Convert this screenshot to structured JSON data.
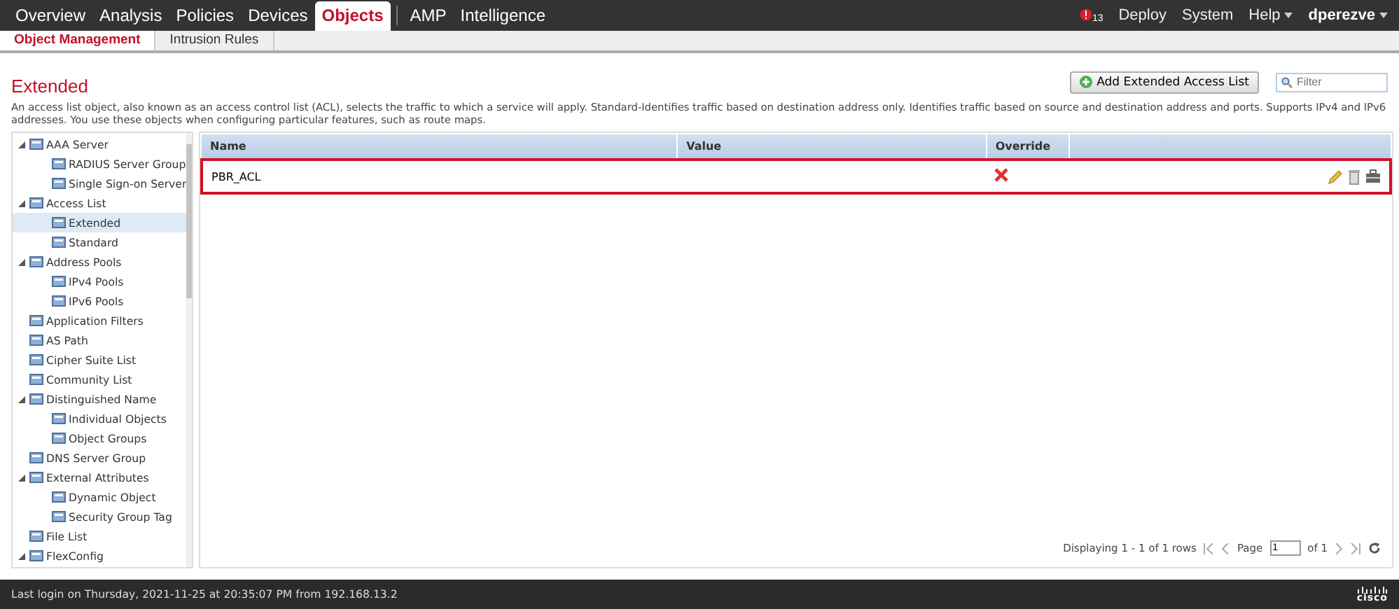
{
  "top_nav": {
    "tabs": [
      {
        "label": "Overview",
        "selected": false
      },
      {
        "label": "Analysis",
        "selected": false
      },
      {
        "label": "Policies",
        "selected": false
      },
      {
        "label": "Devices",
        "selected": false
      },
      {
        "label": "Objects",
        "selected": true
      },
      {
        "label": "AMP",
        "selected": false
      },
      {
        "label": "Intelligence",
        "selected": false
      }
    ],
    "alert_count": "13",
    "links": [
      {
        "label": "Deploy",
        "has_menu": false
      },
      {
        "label": "System",
        "has_menu": false
      },
      {
        "label": "Help",
        "has_menu": true
      }
    ],
    "user": "dperezve"
  },
  "sub_tabs": [
    {
      "label": "Object Management",
      "selected": true
    },
    {
      "label": "Intrusion Rules",
      "selected": false
    }
  ],
  "page": {
    "title": "Extended",
    "add_button": "Add Extended Access List",
    "filter_placeholder": "Filter",
    "description": "An access list object, also known as an access control list (ACL), selects the traffic to which a service will apply. Standard-Identifies traffic based on destination address only. Identifies traffic based on source and destination address and ports. Supports IPv4 and IPv6 addresses. You use these objects when configuring particular features, such as route maps."
  },
  "sidebar": {
    "items": [
      {
        "label": "AAA Server",
        "expanded": true,
        "selected": false,
        "children": [
          {
            "label": "RADIUS Server Group",
            "selected": false
          },
          {
            "label": "Single Sign-on Server",
            "selected": false
          }
        ]
      },
      {
        "label": "Access List",
        "expanded": true,
        "selected": false,
        "children": [
          {
            "label": "Extended",
            "selected": true
          },
          {
            "label": "Standard",
            "selected": false
          }
        ]
      },
      {
        "label": "Address Pools",
        "expanded": true,
        "selected": false,
        "children": [
          {
            "label": "IPv4 Pools",
            "selected": false
          },
          {
            "label": "IPv6 Pools",
            "selected": false
          }
        ]
      },
      {
        "label": "Application Filters",
        "selected": false
      },
      {
        "label": "AS Path",
        "selected": false
      },
      {
        "label": "Cipher Suite List",
        "selected": false
      },
      {
        "label": "Community List",
        "selected": false
      },
      {
        "label": "Distinguished Name",
        "expanded": true,
        "selected": false,
        "children": [
          {
            "label": "Individual Objects",
            "selected": false
          },
          {
            "label": "Object Groups",
            "selected": false
          }
        ]
      },
      {
        "label": "DNS Server Group",
        "selected": false
      },
      {
        "label": "External Attributes",
        "expanded": true,
        "selected": false,
        "children": [
          {
            "label": "Dynamic Object",
            "selected": false
          },
          {
            "label": "Security Group Tag",
            "selected": false
          }
        ]
      },
      {
        "label": "File List",
        "selected": false
      },
      {
        "label": "FlexConfig",
        "expanded": true,
        "selected": false
      }
    ]
  },
  "table": {
    "columns": [
      "Name",
      "Value",
      "Override"
    ],
    "rows": [
      {
        "name": "PBR_ACL",
        "override": false,
        "selected": true
      }
    ]
  },
  "pager": {
    "summary": "Displaying 1 - 1 of 1 rows",
    "page_label": "Page",
    "page": "1",
    "of": "of 1"
  },
  "footer": {
    "last_login": "Last login on Thursday, 2021-11-25 at 20:35:07 PM from 192.168.13.2",
    "logo_text": "cisco"
  }
}
